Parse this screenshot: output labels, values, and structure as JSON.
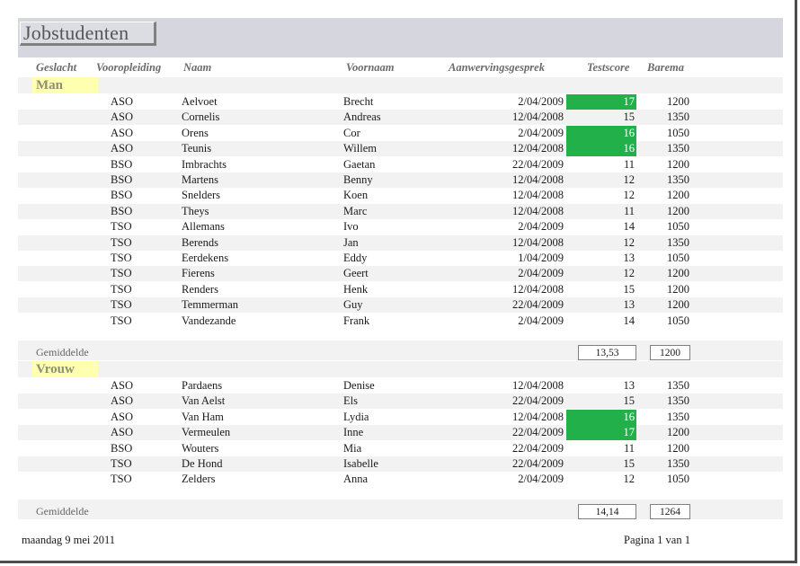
{
  "report": {
    "title": "Jobstudenten",
    "columns": {
      "geslacht": "Geslacht",
      "vooropleiding": "Vooropleiding",
      "naam": "Naam",
      "voornaam": "Voornaam",
      "aanwerving": "Aanwervingsgesprek",
      "testscore": "Testscore",
      "barema": "Barema"
    },
    "highlight_color": "#22b04b",
    "groups": [
      {
        "label": "Man",
        "rows": [
          {
            "opleiding": "ASO",
            "naam": "Aelvoet",
            "voornaam": "Brecht",
            "datum": "2/04/2009",
            "score": "17",
            "barema": "1200",
            "hi": true
          },
          {
            "opleiding": "ASO",
            "naam": "Cornelis",
            "voornaam": "Andreas",
            "datum": "12/04/2008",
            "score": "15",
            "barema": "1350",
            "hi": false
          },
          {
            "opleiding": "ASO",
            "naam": "Orens",
            "voornaam": "Cor",
            "datum": "2/04/2009",
            "score": "16",
            "barema": "1050",
            "hi": true
          },
          {
            "opleiding": "ASO",
            "naam": "Teunis",
            "voornaam": "Willem",
            "datum": "12/04/2008",
            "score": "16",
            "barema": "1350",
            "hi": true
          },
          {
            "opleiding": "BSO",
            "naam": "Imbrachts",
            "voornaam": "Gaetan",
            "datum": "22/04/2009",
            "score": "11",
            "barema": "1200",
            "hi": false
          },
          {
            "opleiding": "BSO",
            "naam": "Martens",
            "voornaam": "Benny",
            "datum": "12/04/2008",
            "score": "12",
            "barema": "1350",
            "hi": false
          },
          {
            "opleiding": "BSO",
            "naam": "Snelders",
            "voornaam": "Koen",
            "datum": "12/04/2008",
            "score": "12",
            "barema": "1200",
            "hi": false
          },
          {
            "opleiding": "BSO",
            "naam": "Theys",
            "voornaam": "Marc",
            "datum": "12/04/2008",
            "score": "11",
            "barema": "1200",
            "hi": false
          },
          {
            "opleiding": "TSO",
            "naam": "Allemans",
            "voornaam": "Ivo",
            "datum": "2/04/2009",
            "score": "14",
            "barema": "1050",
            "hi": false
          },
          {
            "opleiding": "TSO",
            "naam": "Berends",
            "voornaam": "Jan",
            "datum": "12/04/2008",
            "score": "12",
            "barema": "1350",
            "hi": false
          },
          {
            "opleiding": "TSO",
            "naam": "Eerdekens",
            "voornaam": "Eddy",
            "datum": "1/04/2009",
            "score": "13",
            "barema": "1050",
            "hi": false
          },
          {
            "opleiding": "TSO",
            "naam": "Fierens",
            "voornaam": "Geert",
            "datum": "2/04/2009",
            "score": "12",
            "barema": "1200",
            "hi": false
          },
          {
            "opleiding": "TSO",
            "naam": "Renders",
            "voornaam": "Henk",
            "datum": "12/04/2008",
            "score": "15",
            "barema": "1200",
            "hi": false
          },
          {
            "opleiding": "TSO",
            "naam": "Temmerman",
            "voornaam": "Guy",
            "datum": "22/04/2009",
            "score": "13",
            "barema": "1200",
            "hi": false
          },
          {
            "opleiding": "TSO",
            "naam": "Vandezande",
            "voornaam": "Frank",
            "datum": "2/04/2009",
            "score": "14",
            "barema": "1050",
            "hi": false
          }
        ],
        "average_label": "Gemiddelde",
        "average_score": "13,53",
        "average_barema": "1200"
      },
      {
        "label": "Vrouw",
        "rows": [
          {
            "opleiding": "ASO",
            "naam": "Pardaens",
            "voornaam": "Denise",
            "datum": "12/04/2008",
            "score": "13",
            "barema": "1350",
            "hi": false
          },
          {
            "opleiding": "ASO",
            "naam": "Van Aelst",
            "voornaam": "Els",
            "datum": "22/04/2009",
            "score": "15",
            "barema": "1350",
            "hi": false
          },
          {
            "opleiding": "ASO",
            "naam": "Van Ham",
            "voornaam": "Lydia",
            "datum": "12/04/2008",
            "score": "16",
            "barema": "1350",
            "hi": true
          },
          {
            "opleiding": "ASO",
            "naam": "Vermeulen",
            "voornaam": "Inne",
            "datum": "22/04/2009",
            "score": "17",
            "barema": "1200",
            "hi": true
          },
          {
            "opleiding": "BSO",
            "naam": "Wouters",
            "voornaam": "Mia",
            "datum": "22/04/2009",
            "score": "11",
            "barema": "1200",
            "hi": false
          },
          {
            "opleiding": "TSO",
            "naam": "De Hond",
            "voornaam": "Isabelle",
            "datum": "22/04/2009",
            "score": "15",
            "barema": "1350",
            "hi": false
          },
          {
            "opleiding": "TSO",
            "naam": "Zelders",
            "voornaam": "Anna",
            "datum": "2/04/2009",
            "score": "12",
            "barema": "1050",
            "hi": false
          }
        ],
        "average_label": "Gemiddelde",
        "average_score": "14,14",
        "average_barema": "1264"
      }
    ],
    "footer": {
      "date": "maandag 9 mei 2011",
      "page": "Pagina 1 van 1"
    }
  }
}
